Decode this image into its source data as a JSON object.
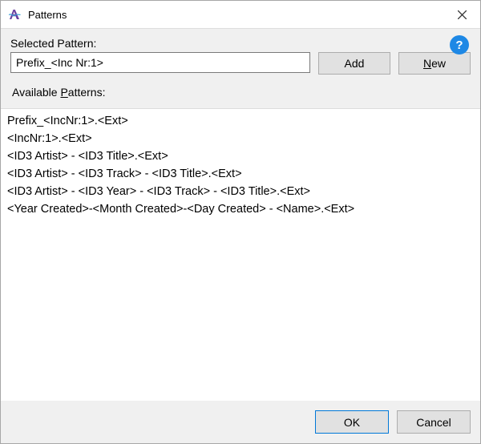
{
  "window": {
    "title": "Patterns"
  },
  "labels": {
    "selected_pattern": "Selected Pattern:",
    "available_patterns": "Available Patterns:"
  },
  "selected_pattern_value": "Prefix_<Inc Nr:1>",
  "buttons": {
    "add": "Add",
    "new_prefix": "N",
    "new_rest": "ew",
    "ok": "OK",
    "cancel": "Cancel"
  },
  "help_icon_glyph": "?",
  "patterns": [
    "Prefix_<IncNr:1>.<Ext>",
    "<IncNr:1>.<Ext>",
    "<ID3 Artist> - <ID3 Title>.<Ext>",
    "<ID3 Artist> - <ID3 Track> - <ID3 Title>.<Ext>",
    "<ID3 Artist> - <ID3 Year> - <ID3 Track> - <ID3 Title>.<Ext>",
    "<Year Created>-<Month Created>-<Day Created> - <Name>.<Ext>"
  ]
}
